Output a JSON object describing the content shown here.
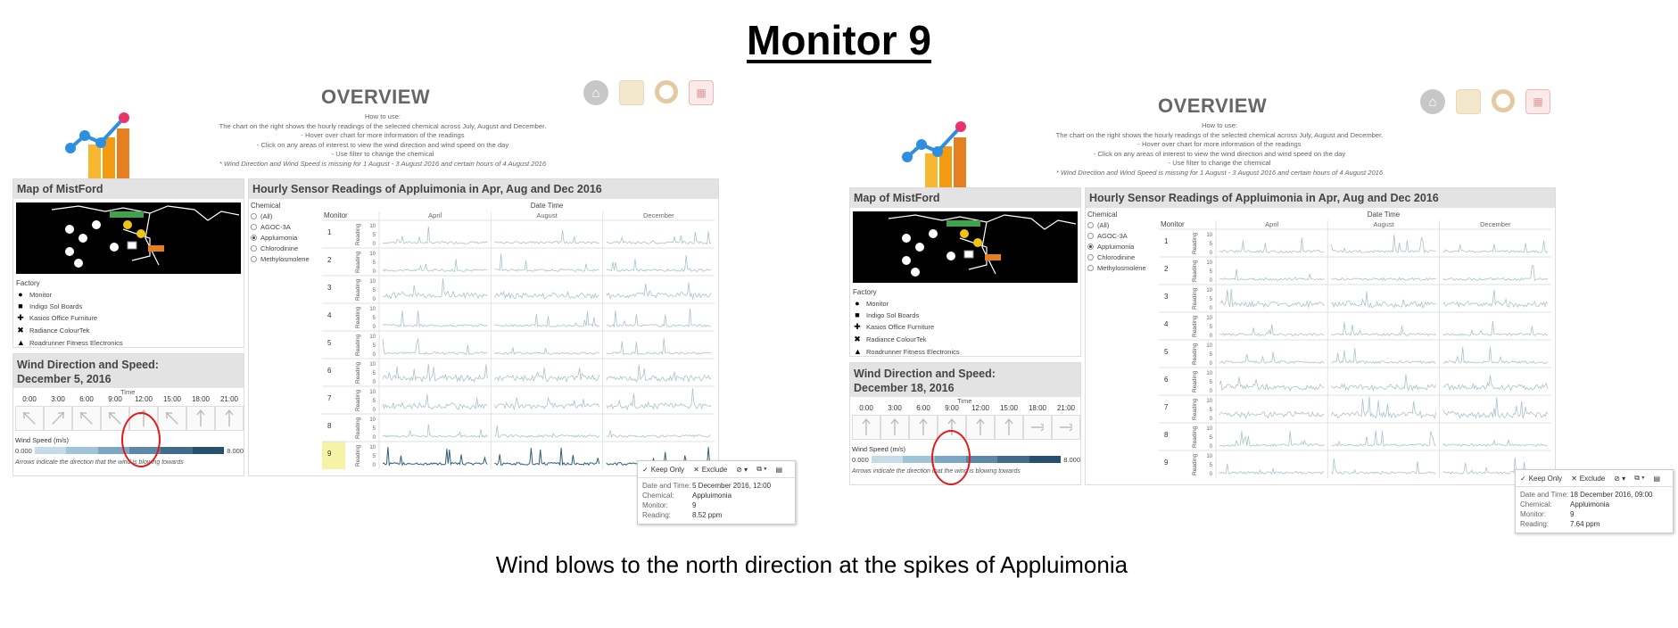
{
  "slide": {
    "title": "Monitor 9",
    "caption": "Wind blows to the north direction at the spikes of Appluimonia"
  },
  "dashboards": [
    {
      "overview_title": "OVERVIEW",
      "how_to": [
        "How to use:",
        "The chart on the right shows the hourly readings of the selected chemical across July, August and December.",
        "- Hover over chart for more information of the readings",
        "- Click on any areas of interest to view the wind direction and wind speed on the day",
        "- Use filter to change the chemical",
        "* Wind Direction and Wind Speed is missing for 1 August - 3 August 2016 and certain hours of 4 August 2016"
      ],
      "map": {
        "title": "Map of MistFord",
        "legend_title": "Factory",
        "legend": [
          {
            "mark": "●",
            "label": "Monitor"
          },
          {
            "mark": "■",
            "label": "Indigo Sol Boards"
          },
          {
            "mark": "✚",
            "label": "Kasios Office Furniture"
          },
          {
            "mark": "✖",
            "label": "Radiance ColourTek"
          },
          {
            "mark": "▲",
            "label": "Roadrunner Fitness Electronics"
          }
        ]
      },
      "wind": {
        "title_line1": "Wind Direction and Speed:",
        "title_line2": "December 5, 2016",
        "time_label": "Time",
        "hours": [
          "0:00",
          "3:00",
          "6:00",
          "9:00",
          "12:00",
          "15:00",
          "18:00",
          "21:00"
        ],
        "arrow_angles": [
          -45,
          45,
          -45,
          -45,
          0,
          -45,
          0,
          0
        ],
        "speed_label": "Wind Speed (m/s)",
        "speed_min": "0.000",
        "speed_max": "8.000",
        "note": "Arrows indicate the direction that the wind is blowing towards",
        "circled_hour": "12:00"
      },
      "chart": {
        "title": "Hourly Sensor Readings of Appluimonia in Apr, Aug and Dec 2016",
        "filter_title": "Chemical",
        "chemicals": [
          "(All)",
          "AGOC-3A",
          "Appluimonia",
          "Chlorodinine",
          "Methylosmolene"
        ],
        "selected_chemical": "Appluimonia",
        "col_header": "Date Time",
        "row_header": "Monitor",
        "months": [
          "April",
          "August",
          "December"
        ],
        "monitors": [
          "1",
          "2",
          "3",
          "4",
          "5",
          "6",
          "7",
          "8",
          "9"
        ],
        "y_label": "Reading",
        "y_ticks": [
          "10",
          "5",
          "0"
        ],
        "highlight_monitor": "9"
      },
      "tooltip": {
        "keep_only": "Keep Only",
        "exclude": "Exclude",
        "rows": [
          {
            "key": "Date and Time:",
            "value": "5 December 2016, 12:00"
          },
          {
            "key": "Chemical:",
            "value": "Appluimonia"
          },
          {
            "key": "Monitor:",
            "value": "9"
          },
          {
            "key": "Reading:",
            "value": "8.52 ppm"
          }
        ]
      }
    },
    {
      "overview_title": "OVERVIEW",
      "how_to": [
        "How to use:",
        "The chart on the right shows the hourly readings of the selected chemical across July, August and December.",
        "- Hover over chart for more information of the readings",
        "- Click on any areas of interest to view the wind direction and wind speed on the day",
        "- Use filter to change the chemical",
        "* Wind Direction and Wind Speed is missing for 1 August - 3 August 2016 and certain hours of 4 August 2016"
      ],
      "map": {
        "title": "Map of MistFord",
        "legend_title": "Factory",
        "legend": [
          {
            "mark": "●",
            "label": "Monitor"
          },
          {
            "mark": "■",
            "label": "Indigo Sol Boards"
          },
          {
            "mark": "✚",
            "label": "Kasios Office Furniture"
          },
          {
            "mark": "✖",
            "label": "Radiance ColourTek"
          },
          {
            "mark": "▲",
            "label": "Roadrunner Fitness Electronics"
          }
        ]
      },
      "wind": {
        "title_line1": "Wind Direction and Speed:",
        "title_line2": "December 18, 2016",
        "time_label": "Time",
        "hours": [
          "0:00",
          "3:00",
          "6:00",
          "9:00",
          "12:00",
          "15:00",
          "18:00",
          "21:00"
        ],
        "arrow_angles": [
          0,
          0,
          0,
          0,
          0,
          0,
          90,
          90
        ],
        "speed_label": "Wind Speed (m/s)",
        "speed_min": "0.000",
        "speed_max": "8.000",
        "note": "Arrows indicate the direction that the wind is blowing towards",
        "circled_hour": "9:00"
      },
      "chart": {
        "title": "Hourly Sensor Readings of Appluimonia in Apr, Aug and Dec 2016",
        "filter_title": "Chemical",
        "chemicals": [
          "(All)",
          "AGOC-3A",
          "Appluimonia",
          "Chlorodinine",
          "Methylosmolene"
        ],
        "selected_chemical": "Appluimonia",
        "col_header": "Date Time",
        "row_header": "Monitor",
        "months": [
          "April",
          "August",
          "December"
        ],
        "monitors": [
          "1",
          "2",
          "3",
          "4",
          "5",
          "6",
          "7",
          "8",
          "9"
        ],
        "y_label": "Reading",
        "y_ticks": [
          "10",
          "5",
          "0"
        ],
        "highlight_monitor": ""
      },
      "tooltip": {
        "keep_only": "Keep Only",
        "exclude": "Exclude",
        "rows": [
          {
            "key": "Date and Time:",
            "value": "18 December 2016, 09:00"
          },
          {
            "key": "Chemical:",
            "value": "Appluimonia"
          },
          {
            "key": "Monitor:",
            "value": "9"
          },
          {
            "key": "Reading:",
            "value": "7.64 ppm"
          }
        ]
      }
    }
  ],
  "colors": {
    "line": "#a9c3cb",
    "line_dark": "#2f5f78",
    "highlight": "#f4f3a6",
    "circle": "#e01b1b",
    "speed_scale": [
      "#c6dbe8",
      "#9ec4da",
      "#7aa7c4",
      "#5b88a8",
      "#3f6b8c",
      "#27506f"
    ]
  }
}
